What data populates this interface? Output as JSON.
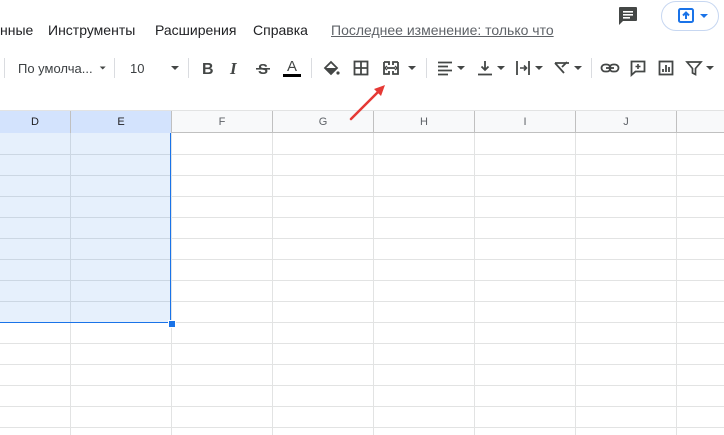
{
  "menu": {
    "items": [
      "нные",
      "Инструменты",
      "Расширения",
      "Справка"
    ],
    "last_edit": "Последнее изменение: только что"
  },
  "toolbar": {
    "font_family": "По умолча...",
    "font_size": "10",
    "icons": [
      "bold-icon",
      "italic-icon",
      "strikethrough-icon",
      "text-color-icon",
      "fill-color-icon",
      "borders-icon",
      "merge-cells-icon",
      "horizontal-align-icon",
      "vertical-align-icon",
      "text-wrap-icon",
      "text-rotation-icon",
      "link-icon",
      "comment-icon",
      "chart-icon",
      "filter-icon"
    ],
    "text_color_bar": "#000000"
  },
  "columns": [
    "D",
    "E",
    "F",
    "G",
    "H",
    "I",
    "J"
  ],
  "selected_columns": [
    "D",
    "E"
  ],
  "colors": {
    "accent": "#1a73e8",
    "annotation_arrow": "#e53935"
  }
}
